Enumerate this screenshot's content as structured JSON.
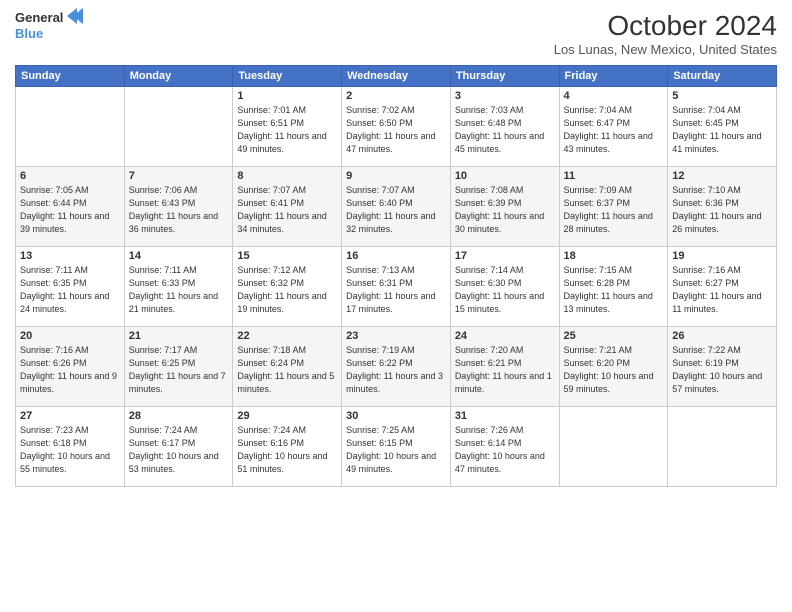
{
  "header": {
    "logo_line1": "General",
    "logo_line2": "Blue",
    "month": "October 2024",
    "location": "Los Lunas, New Mexico, United States"
  },
  "weekdays": [
    "Sunday",
    "Monday",
    "Tuesday",
    "Wednesday",
    "Thursday",
    "Friday",
    "Saturday"
  ],
  "weeks": [
    [
      {
        "day": "",
        "info": ""
      },
      {
        "day": "",
        "info": ""
      },
      {
        "day": "1",
        "info": "Sunrise: 7:01 AM\nSunset: 6:51 PM\nDaylight: 11 hours and 49 minutes."
      },
      {
        "day": "2",
        "info": "Sunrise: 7:02 AM\nSunset: 6:50 PM\nDaylight: 11 hours and 47 minutes."
      },
      {
        "day": "3",
        "info": "Sunrise: 7:03 AM\nSunset: 6:48 PM\nDaylight: 11 hours and 45 minutes."
      },
      {
        "day": "4",
        "info": "Sunrise: 7:04 AM\nSunset: 6:47 PM\nDaylight: 11 hours and 43 minutes."
      },
      {
        "day": "5",
        "info": "Sunrise: 7:04 AM\nSunset: 6:45 PM\nDaylight: 11 hours and 41 minutes."
      }
    ],
    [
      {
        "day": "6",
        "info": "Sunrise: 7:05 AM\nSunset: 6:44 PM\nDaylight: 11 hours and 39 minutes."
      },
      {
        "day": "7",
        "info": "Sunrise: 7:06 AM\nSunset: 6:43 PM\nDaylight: 11 hours and 36 minutes."
      },
      {
        "day": "8",
        "info": "Sunrise: 7:07 AM\nSunset: 6:41 PM\nDaylight: 11 hours and 34 minutes."
      },
      {
        "day": "9",
        "info": "Sunrise: 7:07 AM\nSunset: 6:40 PM\nDaylight: 11 hours and 32 minutes."
      },
      {
        "day": "10",
        "info": "Sunrise: 7:08 AM\nSunset: 6:39 PM\nDaylight: 11 hours and 30 minutes."
      },
      {
        "day": "11",
        "info": "Sunrise: 7:09 AM\nSunset: 6:37 PM\nDaylight: 11 hours and 28 minutes."
      },
      {
        "day": "12",
        "info": "Sunrise: 7:10 AM\nSunset: 6:36 PM\nDaylight: 11 hours and 26 minutes."
      }
    ],
    [
      {
        "day": "13",
        "info": "Sunrise: 7:11 AM\nSunset: 6:35 PM\nDaylight: 11 hours and 24 minutes."
      },
      {
        "day": "14",
        "info": "Sunrise: 7:11 AM\nSunset: 6:33 PM\nDaylight: 11 hours and 21 minutes."
      },
      {
        "day": "15",
        "info": "Sunrise: 7:12 AM\nSunset: 6:32 PM\nDaylight: 11 hours and 19 minutes."
      },
      {
        "day": "16",
        "info": "Sunrise: 7:13 AM\nSunset: 6:31 PM\nDaylight: 11 hours and 17 minutes."
      },
      {
        "day": "17",
        "info": "Sunrise: 7:14 AM\nSunset: 6:30 PM\nDaylight: 11 hours and 15 minutes."
      },
      {
        "day": "18",
        "info": "Sunrise: 7:15 AM\nSunset: 6:28 PM\nDaylight: 11 hours and 13 minutes."
      },
      {
        "day": "19",
        "info": "Sunrise: 7:16 AM\nSunset: 6:27 PM\nDaylight: 11 hours and 11 minutes."
      }
    ],
    [
      {
        "day": "20",
        "info": "Sunrise: 7:16 AM\nSunset: 6:26 PM\nDaylight: 11 hours and 9 minutes."
      },
      {
        "day": "21",
        "info": "Sunrise: 7:17 AM\nSunset: 6:25 PM\nDaylight: 11 hours and 7 minutes."
      },
      {
        "day": "22",
        "info": "Sunrise: 7:18 AM\nSunset: 6:24 PM\nDaylight: 11 hours and 5 minutes."
      },
      {
        "day": "23",
        "info": "Sunrise: 7:19 AM\nSunset: 6:22 PM\nDaylight: 11 hours and 3 minutes."
      },
      {
        "day": "24",
        "info": "Sunrise: 7:20 AM\nSunset: 6:21 PM\nDaylight: 11 hours and 1 minute."
      },
      {
        "day": "25",
        "info": "Sunrise: 7:21 AM\nSunset: 6:20 PM\nDaylight: 10 hours and 59 minutes."
      },
      {
        "day": "26",
        "info": "Sunrise: 7:22 AM\nSunset: 6:19 PM\nDaylight: 10 hours and 57 minutes."
      }
    ],
    [
      {
        "day": "27",
        "info": "Sunrise: 7:23 AM\nSunset: 6:18 PM\nDaylight: 10 hours and 55 minutes."
      },
      {
        "day": "28",
        "info": "Sunrise: 7:24 AM\nSunset: 6:17 PM\nDaylight: 10 hours and 53 minutes."
      },
      {
        "day": "29",
        "info": "Sunrise: 7:24 AM\nSunset: 6:16 PM\nDaylight: 10 hours and 51 minutes."
      },
      {
        "day": "30",
        "info": "Sunrise: 7:25 AM\nSunset: 6:15 PM\nDaylight: 10 hours and 49 minutes."
      },
      {
        "day": "31",
        "info": "Sunrise: 7:26 AM\nSunset: 6:14 PM\nDaylight: 10 hours and 47 minutes."
      },
      {
        "day": "",
        "info": ""
      },
      {
        "day": "",
        "info": ""
      }
    ]
  ]
}
